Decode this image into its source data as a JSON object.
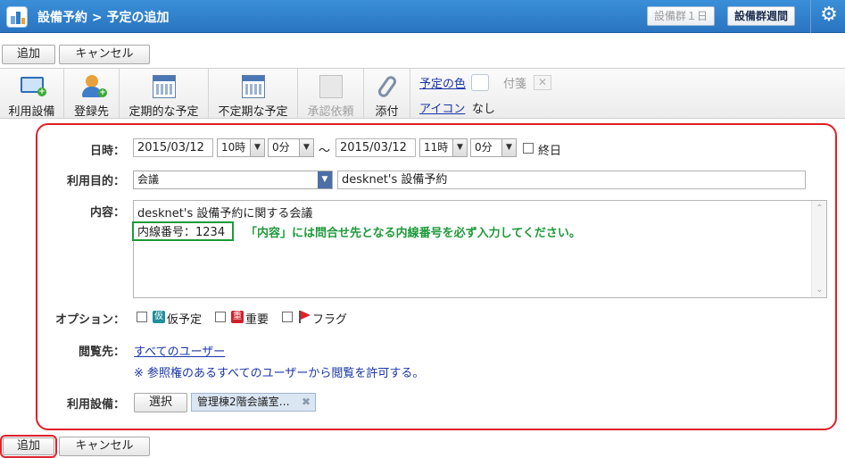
{
  "header": {
    "title": "設備予約 > 予定の追加",
    "btn_day": "設備群１日",
    "btn_week": "設備群週間"
  },
  "top_buttons": {
    "add": "追加",
    "cancel": "キャンセル"
  },
  "toolbar": {
    "items": [
      {
        "label": "利用設備",
        "icon": "monitor-add-icon"
      },
      {
        "label": "登録先",
        "icon": "users-add-icon"
      },
      {
        "label": "定期的な予定",
        "icon": "calendar-icon"
      },
      {
        "label": "不定期な予定",
        "icon": "calendar-icon"
      },
      {
        "label": "承認依頼",
        "icon": "approval-icon",
        "disabled": true
      },
      {
        "label": "添付",
        "icon": "paperclip-icon"
      }
    ],
    "color_link": "予定の色",
    "sticky_label": "付箋",
    "icon_link": "アイコン",
    "icon_value": "なし"
  },
  "form": {
    "datetime": {
      "label": "日時：",
      "start_date": "2015/03/12",
      "start_hour": "10時",
      "start_min": "0分",
      "tilde": "～",
      "end_date": "2015/03/12",
      "end_hour": "11時",
      "end_min": "0分",
      "allday": "終日"
    },
    "purpose": {
      "label": "利用目的：",
      "category": "会議",
      "title": "desknet's 設備予約"
    },
    "content": {
      "label": "内容：",
      "line1": "desknet's 設備予約に関する会議",
      "line2": "内線番号：1234",
      "note": "「内容」には問合せ先となる内線番号を必ず入力してください。"
    },
    "options": {
      "label": "オプション：",
      "tentative_icon": "仮",
      "tentative": "仮予定",
      "important_icon": "重",
      "important": "重要",
      "flag": "フラグ"
    },
    "viewers": {
      "label": "閲覧先：",
      "link": "すべてのユーザー",
      "note": "※ 参照権のあるすべてのユーザーから閲覧を許可する。"
    },
    "equipment": {
      "label": "利用設備：",
      "select": "選択",
      "chip": "管理棟2階会議室…"
    }
  },
  "bottom_buttons": {
    "add": "追加",
    "cancel": "キャンセル"
  },
  "colors": {
    "header": "#2f7cc8",
    "annotation_red": "#e0202a",
    "annotation_green": "#1e9a3a",
    "link": "#1a35a8"
  }
}
